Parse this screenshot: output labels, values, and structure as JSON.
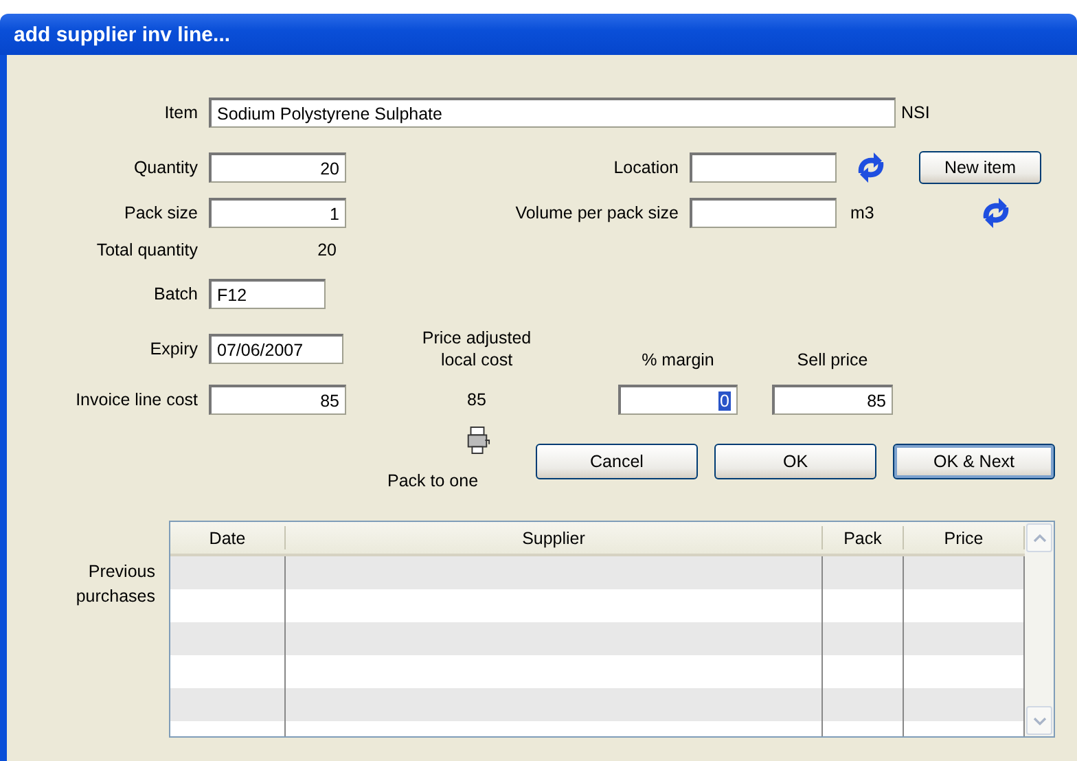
{
  "window": {
    "title": "add supplier inv line..."
  },
  "item": {
    "label": "Item",
    "value": "Sodium Polystyrene Sulphate",
    "code": "NSI"
  },
  "quantity": {
    "label": "Quantity",
    "value": "20"
  },
  "location": {
    "label": "Location"
  },
  "new_item_button": "New item",
  "pack_size": {
    "label": "Pack size",
    "value": "1"
  },
  "volume": {
    "label": "Volume per pack size",
    "unit": "m3"
  },
  "total_quantity": {
    "label": "Total quantity",
    "value": "20"
  },
  "batch": {
    "label": "Batch",
    "value": "F12"
  },
  "expiry": {
    "label": "Expiry",
    "value": "07/06/2007"
  },
  "price_adjusted": {
    "label": "Price adjusted local cost",
    "value": "85"
  },
  "margin": {
    "label": "% margin",
    "value": "0",
    "text_selected": true
  },
  "sell_price": {
    "label": "Sell price",
    "value": "85"
  },
  "invoice_line_cost": {
    "label": "Invoice line cost",
    "value": "85"
  },
  "pack_to_one": {
    "label": "Pack to one"
  },
  "buttons": [
    {
      "label": "Cancel",
      "default": false
    },
    {
      "label": "OK",
      "default": false
    },
    {
      "label": "OK & Next",
      "default": true
    }
  ],
  "previous_purchases": {
    "label": "Previous purchases",
    "columns": [
      "Date",
      "Supplier",
      "Pack",
      "Price"
    ]
  }
}
